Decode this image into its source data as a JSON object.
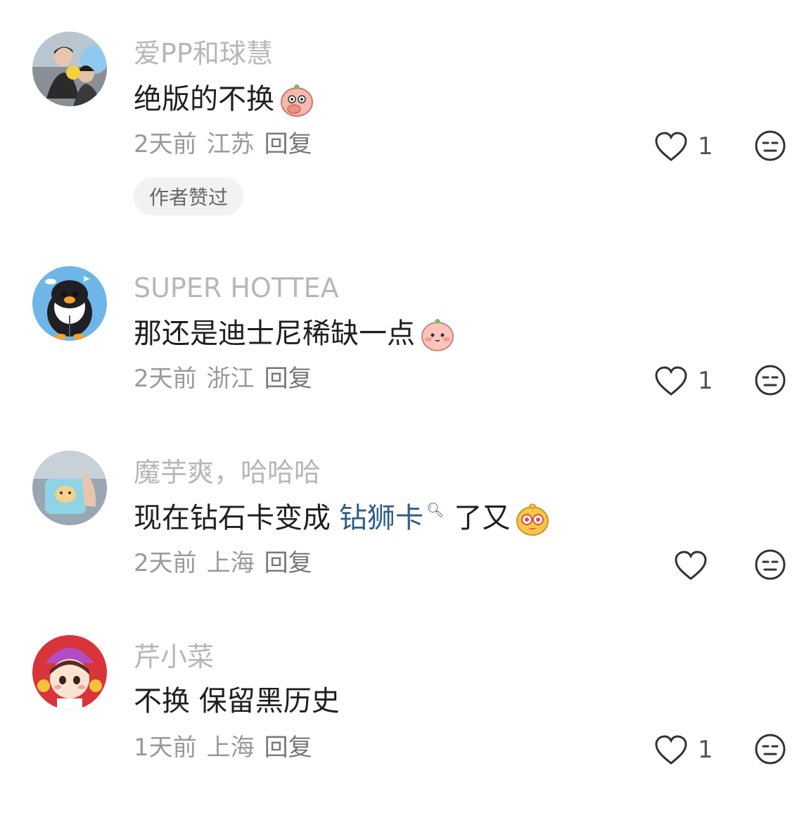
{
  "comments": [
    {
      "username": "爱PP和球慧",
      "text": "绝版的不换",
      "time": "2天前",
      "location": "江苏",
      "reply_label": "回复",
      "likes": "1",
      "badge": "作者赞过",
      "emoji": "covering-mouth-peach-emoji"
    },
    {
      "username": "SUPER HOTTEA",
      "text": "那还是迪士尼稀缺一点",
      "time": "2天前",
      "location": "浙江",
      "reply_label": "回复",
      "likes": "1",
      "emoji": "shy-peach-emoji"
    },
    {
      "username": "魔芋爽，哈哈哈",
      "text_before": "现在钻石卡变成",
      "link": "钻狮卡",
      "text_after": "了又",
      "time": "2天前",
      "location": "上海",
      "reply_label": "回复",
      "emoji": "starry-eyes-emoji"
    },
    {
      "username": "芹小菜",
      "text": "不换 保留黑历史",
      "time": "1天前",
      "location": "上海",
      "reply_label": "回复",
      "likes": "1"
    }
  ],
  "colors": {
    "username": "#b7b7b7",
    "meta": "#9a9a9a",
    "link": "#2f5e8c",
    "text": "#1f1f1f"
  }
}
